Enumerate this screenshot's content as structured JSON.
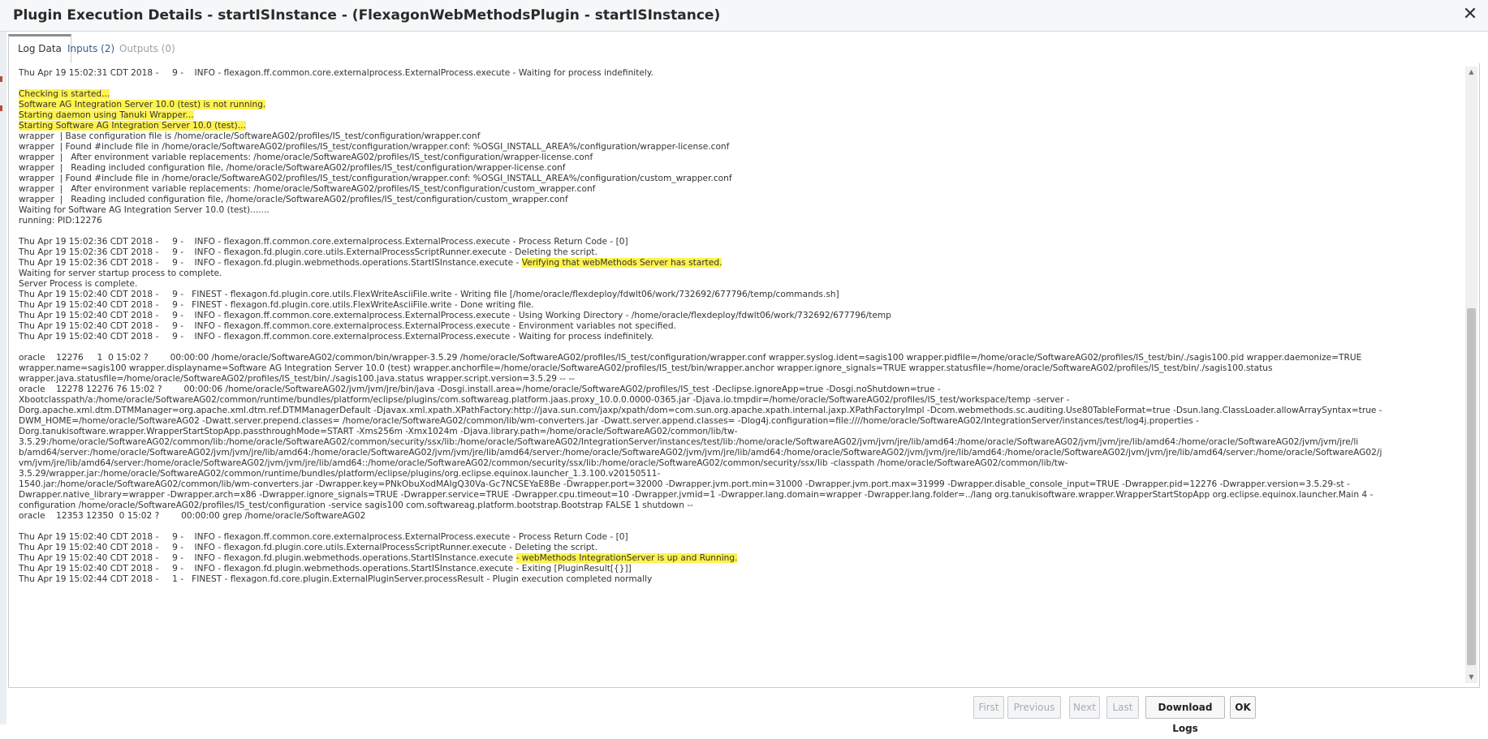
{
  "dialog": {
    "title": "Plugin Execution Details - startISInstance - (FlexagonWebMethodsPlugin - startISInstance)",
    "close_glyph": "✕"
  },
  "tabs": [
    {
      "label": "Log Data",
      "active": true
    },
    {
      "label": "Inputs (2)",
      "active": false
    },
    {
      "label": "Outputs (0)",
      "active": false
    }
  ],
  "log": {
    "lines": [
      {
        "segments": [
          {
            "text": "Thu Apr 19 15:02:31 CDT 2018 -     9 -    INFO - flexagon.ff.common.core.externalprocess.ExternalProcess.execute - Waiting for process indefinitely."
          }
        ]
      },
      {
        "segments": [
          {
            "text": ""
          }
        ]
      },
      {
        "segments": [
          {
            "text": "Checking is started...",
            "highlight": true
          }
        ]
      },
      {
        "segments": [
          {
            "text": "Software AG Integration Server 10.0 (test) is not running.",
            "highlight": true
          }
        ]
      },
      {
        "segments": [
          {
            "text": "Starting daemon using Tanuki Wrapper...",
            "highlight": true
          }
        ]
      },
      {
        "segments": [
          {
            "text": "Starting Software AG Integration Server 10.0 (test)...",
            "highlight": true
          }
        ]
      },
      {
        "segments": [
          {
            "text": "wrapper  | Base configuration file is /home/oracle/SoftwareAG02/profiles/IS_test/configuration/wrapper.conf"
          }
        ]
      },
      {
        "segments": [
          {
            "text": "wrapper  | Found #include file in /home/oracle/SoftwareAG02/profiles/IS_test/configuration/wrapper.conf: %OSGI_INSTALL_AREA%/configuration/wrapper-license.conf"
          }
        ]
      },
      {
        "segments": [
          {
            "text": "wrapper  |   After environment variable replacements: /home/oracle/SoftwareAG02/profiles/IS_test/configuration/wrapper-license.conf"
          }
        ]
      },
      {
        "segments": [
          {
            "text": "wrapper  |   Reading included configuration file, /home/oracle/SoftwareAG02/profiles/IS_test/configuration/wrapper-license.conf"
          }
        ]
      },
      {
        "segments": [
          {
            "text": "wrapper  | Found #include file in /home/oracle/SoftwareAG02/profiles/IS_test/configuration/wrapper.conf: %OSGI_INSTALL_AREA%/configuration/custom_wrapper.conf"
          }
        ]
      },
      {
        "segments": [
          {
            "text": "wrapper  |   After environment variable replacements: /home/oracle/SoftwareAG02/profiles/IS_test/configuration/custom_wrapper.conf"
          }
        ]
      },
      {
        "segments": [
          {
            "text": "wrapper  |   Reading included configuration file, /home/oracle/SoftwareAG02/profiles/IS_test/configuration/custom_wrapper.conf"
          }
        ]
      },
      {
        "segments": [
          {
            "text": "Waiting for Software AG Integration Server 10.0 (test)......."
          }
        ]
      },
      {
        "segments": [
          {
            "text": "running: PID:12276"
          }
        ]
      },
      {
        "segments": [
          {
            "text": ""
          }
        ]
      },
      {
        "segments": [
          {
            "text": "Thu Apr 19 15:02:36 CDT 2018 -     9 -    INFO - flexagon.ff.common.core.externalprocess.ExternalProcess.execute - Process Return Code - [0]"
          }
        ]
      },
      {
        "segments": [
          {
            "text": "Thu Apr 19 15:02:36 CDT 2018 -     9 -    INFO - flexagon.fd.plugin.core.utils.ExternalProcessScriptRunner.execute - Deleting the script."
          }
        ]
      },
      {
        "segments": [
          {
            "text": "Thu Apr 19 15:02:36 CDT 2018 -     9 -    INFO - flexagon.fd.plugin.webmethods.operations.StartISInstance.execute - "
          },
          {
            "text": "Verifying that webMethods Server has started.",
            "highlight": true
          }
        ]
      },
      {
        "segments": [
          {
            "text": "Waiting for server startup process to complete."
          }
        ]
      },
      {
        "segments": [
          {
            "text": "Server Process is complete."
          }
        ]
      },
      {
        "segments": [
          {
            "text": "Thu Apr 19 15:02:40 CDT 2018 -     9 -   FINEST - flexagon.fd.plugin.core.utils.FlexWriteAsciiFile.write - Writing file [/home/oracle/flexdeploy/fdwlt06/work/732692/677796/temp/commands.sh]"
          }
        ]
      },
      {
        "segments": [
          {
            "text": "Thu Apr 19 15:02:40 CDT 2018 -     9 -   FINEST - flexagon.fd.plugin.core.utils.FlexWriteAsciiFile.write - Done writing file."
          }
        ]
      },
      {
        "segments": [
          {
            "text": "Thu Apr 19 15:02:40 CDT 2018 -     9 -    INFO - flexagon.ff.common.core.externalprocess.ExternalProcess.execute - Using Working Directory - /home/oracle/flexdeploy/fdwlt06/work/732692/677796/temp"
          }
        ]
      },
      {
        "segments": [
          {
            "text": "Thu Apr 19 15:02:40 CDT 2018 -     9 -    INFO - flexagon.ff.common.core.externalprocess.ExternalProcess.execute - Environment variables not specified."
          }
        ]
      },
      {
        "segments": [
          {
            "text": "Thu Apr 19 15:02:40 CDT 2018 -     9 -    INFO - flexagon.ff.common.core.externalprocess.ExternalProcess.execute - Waiting for process indefinitely."
          }
        ]
      },
      {
        "segments": [
          {
            "text": ""
          }
        ]
      },
      {
        "segments": [
          {
            "text": "oracle    12276     1  0 15:02 ?        00:00:00 /home/oracle/SoftwareAG02/common/bin/wrapper-3.5.29 /home/oracle/SoftwareAG02/profiles/IS_test/configuration/wrapper.conf wrapper.syslog.ident=sagis100 wrapper.pidfile=/home/oracle/SoftwareAG02/profiles/IS_test/bin/./sagis100.pid wrapper.daemonize=TRUE"
          }
        ]
      },
      {
        "segments": [
          {
            "text": "wrapper.name=sagis100 wrapper.displayname=Software AG Integration Server 10.0 (test) wrapper.anchorfile=/home/oracle/SoftwareAG02/profiles/IS_test/bin/wrapper.anchor wrapper.ignore_signals=TRUE wrapper.statusfile=/home/oracle/SoftwareAG02/profiles/IS_test/bin/./sagis100.status"
          }
        ]
      },
      {
        "segments": [
          {
            "text": "wrapper.java.statusfile=/home/oracle/SoftwareAG02/profiles/IS_test/bin/./sagis100.java.status wrapper.script.version=3.5.29 -- --"
          }
        ]
      },
      {
        "segments": [
          {
            "text": "oracle    12278 12276 76 15:02 ?        00:00:06 /home/oracle/SoftwareAG02/jvm/jvm/jre/bin/java -Dosgi.install.area=/home/oracle/SoftwareAG02/profiles/IS_test -Declipse.ignoreApp=true -Dosgi.noShutdown=true -"
          }
        ]
      },
      {
        "segments": [
          {
            "text": "Xbootclasspath/a:/home/oracle/SoftwareAG02/common/runtime/bundles/platform/eclipse/plugins/com.softwareag.platform.jaas.proxy_10.0.0.0000-0365.jar -Djava.io.tmpdir=/home/oracle/SoftwareAG02/profiles/IS_test/workspace/temp -server -"
          }
        ]
      },
      {
        "segments": [
          {
            "text": "Dorg.apache.xml.dtm.DTMManager=org.apache.xml.dtm.ref.DTMManagerDefault -Djavax.xml.xpath.XPathFactory:http://java.sun.com/jaxp/xpath/dom=com.sun.org.apache.xpath.internal.jaxp.XPathFactoryImpl -Dcom.webmethods.sc.auditing.Use80TableFormat=true -Dsun.lang.ClassLoader.allowArraySyntax=true -"
          }
        ]
      },
      {
        "segments": [
          {
            "text": "DWM_HOME=/home/oracle/SoftwareAG02 -Dwatt.server.prepend.classes= /home/oracle/SoftwareAG02/common/lib/wm-converters.jar -Dwatt.server.append.classes= -Dlog4j.configuration=file:////home/oracle/SoftwareAG02/IntegrationServer/instances/test/log4j.properties -"
          }
        ]
      },
      {
        "segments": [
          {
            "text": "Dorg.tanukisoftware.wrapper.WrapperStartStopApp.passthroughMode=START -Xms256m -Xmx1024m -Djava.library.path=/home/oracle/SoftwareAG02/common/lib/tw-"
          }
        ]
      },
      {
        "segments": [
          {
            "text": "3.5.29:/home/oracle/SoftwareAG02/common/lib:/home/oracle/SoftwareAG02/common/security/ssx/lib:/home/oracle/SoftwareAG02/IntegrationServer/instances/test/lib:/home/oracle/SoftwareAG02/jvm/jvm/jre/lib/amd64:/home/oracle/SoftwareAG02/jvm/jvm/jre/lib/amd64:/home/oracle/SoftwareAG02/jvm/jvm/jre/li"
          }
        ]
      },
      {
        "segments": [
          {
            "text": "b/amd64/server:/home/oracle/SoftwareAG02/jvm/jvm/jre/lib/amd64:/home/oracle/SoftwareAG02/jvm/jvm/jre/lib/amd64/server:/home/oracle/SoftwareAG02/jvm/jvm/jre/lib/amd64:/home/oracle/SoftwareAG02/jvm/jvm/jre/lib/amd64:/home/oracle/SoftwareAG02/jvm/jvm/jre/lib/amd64/server:/home/oracle/SoftwareAG02/j"
          }
        ]
      },
      {
        "segments": [
          {
            "text": "vm/jvm/jre/lib/amd64/server:/home/oracle/SoftwareAG02/jvm/jvm/jre/lib/amd64::/home/oracle/SoftwareAG02/common/security/ssx/lib:/home/oracle/SoftwareAG02/common/security/ssx/lib -classpath /home/oracle/SoftwareAG02/common/lib/tw-"
          }
        ]
      },
      {
        "segments": [
          {
            "text": "3.5.29/wrapper.jar:/home/oracle/SoftwareAG02/common/runtime/bundles/platform/eclipse/plugins/org.eclipse.equinox.launcher_1.3.100.v20150511-"
          }
        ]
      },
      {
        "segments": [
          {
            "text": "1540.jar:/home/oracle/SoftwareAG02/common/lib/wm-converters.jar -Dwrapper.key=PNkObuXodMAIgQ30Va-Gc7NCSEYaE8Be -Dwrapper.port=32000 -Dwrapper.jvm.port.min=31000 -Dwrapper.jvm.port.max=31999 -Dwrapper.disable_console_input=TRUE -Dwrapper.pid=12276 -Dwrapper.version=3.5.29-st -"
          }
        ]
      },
      {
        "segments": [
          {
            "text": "Dwrapper.native_library=wrapper -Dwrapper.arch=x86 -Dwrapper.ignore_signals=TRUE -Dwrapper.service=TRUE -Dwrapper.cpu.timeout=10 -Dwrapper.jvmid=1 -Dwrapper.lang.domain=wrapper -Dwrapper.lang.folder=../lang org.tanukisoftware.wrapper.WrapperStartStopApp org.eclipse.equinox.launcher.Main 4 -"
          }
        ]
      },
      {
        "segments": [
          {
            "text": "configuration /home/oracle/SoftwareAG02/profiles/IS_test/configuration -service sagis100 com.softwareag.platform.bootstrap.Bootstrap FALSE 1 shutdown --"
          }
        ]
      },
      {
        "segments": [
          {
            "text": "oracle    12353 12350  0 15:02 ?        00:00:00 grep /home/oracle/SoftwareAG02"
          }
        ]
      },
      {
        "segments": [
          {
            "text": ""
          }
        ]
      },
      {
        "segments": [
          {
            "text": "Thu Apr 19 15:02:40 CDT 2018 -     9 -    INFO - flexagon.ff.common.core.externalprocess.ExternalProcess.execute - Process Return Code - [0]"
          }
        ]
      },
      {
        "segments": [
          {
            "text": "Thu Apr 19 15:02:40 CDT 2018 -     9 -    INFO - flexagon.fd.plugin.core.utils.ExternalProcessScriptRunner.execute - Deleting the script."
          }
        ]
      },
      {
        "segments": [
          {
            "text": "Thu Apr 19 15:02:40 CDT 2018 -     9 -    INFO - flexagon.fd.plugin.webmethods.operations.StartISInstance.execute "
          },
          {
            "text": "- webMethods IntegrationServer is up and Running.",
            "highlight": true
          }
        ]
      },
      {
        "segments": [
          {
            "text": "Thu Apr 19 15:02:40 CDT 2018 -     9 -    INFO - flexagon.fd.plugin.webmethods.operations.StartISInstance.execute - Exiting [PluginResult[{}]]"
          }
        ]
      },
      {
        "segments": [
          {
            "text": "Thu Apr 19 15:02:44 CDT 2018 -     1 -   FINEST - flexagon.fd.core.plugin.ExternalPluginServer.processResult - Plugin execution completed normally"
          }
        ]
      }
    ]
  },
  "footer": {
    "first_label": "First",
    "previous_label": "Previous",
    "next_label": "Next",
    "last_label": "Last",
    "download_label": "Download Logs",
    "ok_label": "OK"
  },
  "colors": {
    "highlight": "#fff34d",
    "tab_link": "#2e5e8f"
  }
}
